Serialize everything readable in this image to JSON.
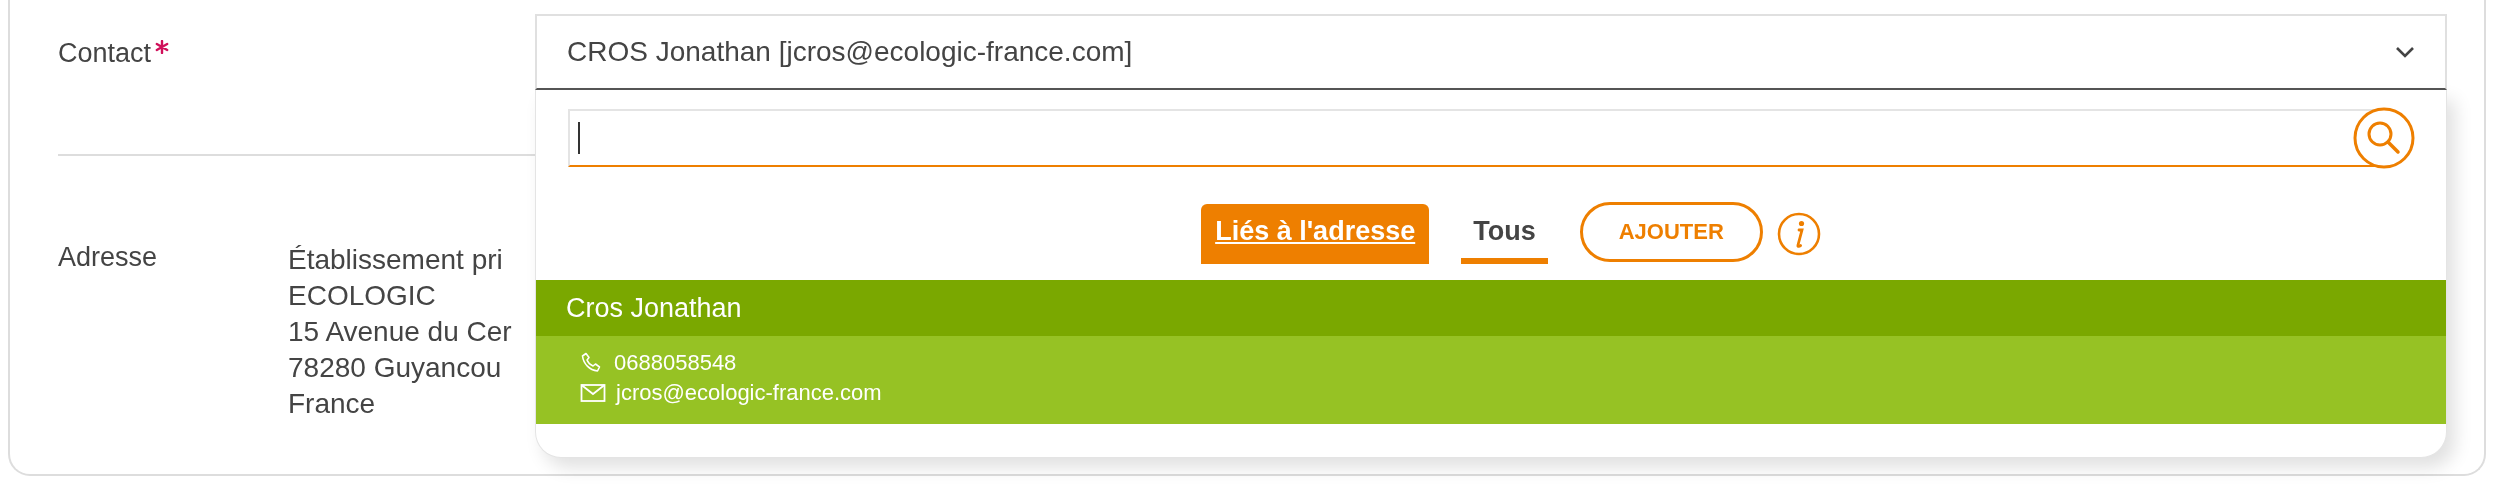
{
  "contact_field": {
    "label": "Contact",
    "required": true,
    "value": "CROS Jonathan [jcros@ecologic-france.com]"
  },
  "address_field": {
    "label": "Adresse",
    "lines": [
      "Établissement pri",
      "ECOLOGIC",
      "15 Avenue du Cer",
      "78280 Guyancou",
      "France"
    ]
  },
  "dropdown": {
    "tabs": [
      {
        "label": "Liés à l'adresse",
        "selected": false,
        "highlighted": true
      },
      {
        "label": "Tous",
        "selected": true,
        "highlighted": false
      }
    ],
    "add_button": "AJOUTER",
    "results": [
      {
        "name": "Cros Jonathan",
        "phone": "0688058548",
        "email": "jcros@ecologic-france.com",
        "selected": true
      }
    ]
  }
}
